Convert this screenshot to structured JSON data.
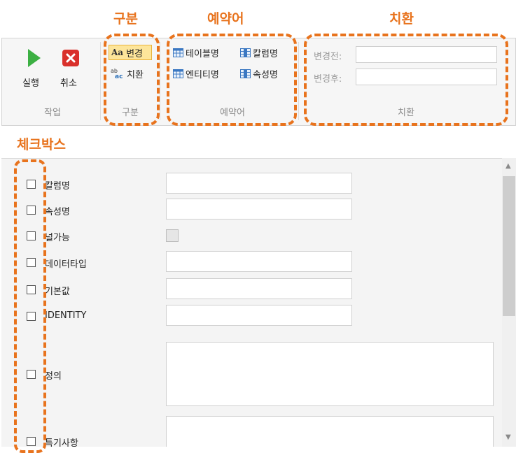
{
  "callouts": {
    "category": "구분",
    "reserved": "예약어",
    "replace": "치환",
    "checkbox": "체크박스"
  },
  "ribbon": {
    "action_group": {
      "label": "작업",
      "run_label": "실행",
      "cancel_label": "취소"
    },
    "category_group": {
      "label": "구분",
      "change_label": "변경",
      "change_icon_text": "Aa",
      "replace_label": "치환",
      "replace_icon_text": "ab/ac"
    },
    "reserved_group": {
      "label": "예약어",
      "table_name": "테이블명",
      "column_name": "칼럼명",
      "entity_name": "엔티티명",
      "attribute_name": "속성명"
    },
    "replace_group": {
      "label": "치환",
      "before_label": "변경전:",
      "before_value": "",
      "after_label": "변경후:",
      "after_value": ""
    }
  },
  "properties": {
    "column_name": "칼럼명",
    "attribute_name": "속성명",
    "nullable": "널가능",
    "data_type": "데이터타입",
    "default_value": "기본값",
    "identity": "IDENTITY",
    "definition": "정의",
    "remarks": "특기사항"
  },
  "colors": {
    "callout": "#e8731d",
    "run_icon": "#3cb043",
    "cancel_icon": "#d9302b",
    "active_button": "#fde59a"
  }
}
